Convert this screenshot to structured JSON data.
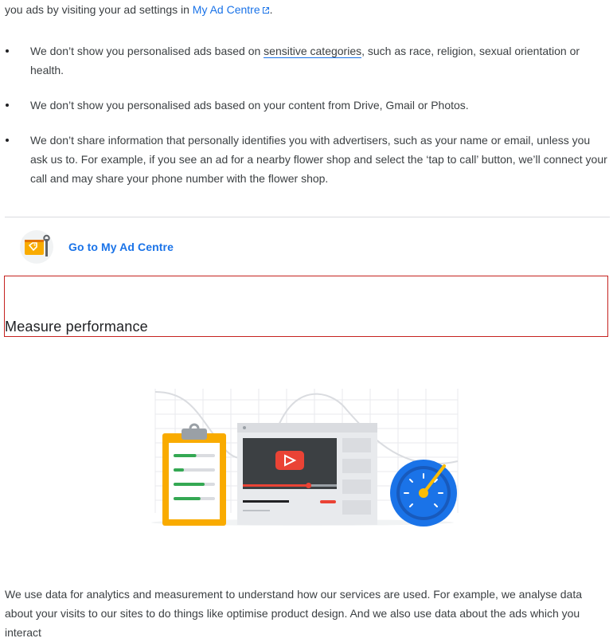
{
  "intro": {
    "prefix": "you ads by visiting your ad settings in ",
    "link": "My Ad Centre",
    "suffix": "."
  },
  "bullets": [
    {
      "pre": "We don’t show you personalised ads based on ",
      "link": "sensitive categories",
      "post": ", such as race, religion, sexual orientation or health."
    },
    {
      "text": "We don’t show you personalised ads based on your content from Drive, Gmail or Photos."
    },
    {
      "text": "We don’t share information that personally identifies you with advertisers, such as your name or email, unless you ask us to. For example, if you see an ad for a nearby flower shop and select the ‘tap to call’ button, we’ll connect your call and may share your phone number with the flower shop."
    }
  ],
  "ad_centre": {
    "link_label": "Go to My Ad Centre",
    "icon": "ad-settings-tag-wrench-icon"
  },
  "section": {
    "title": "Measure performance"
  },
  "illustration": {
    "name": "measure-performance-illustration",
    "progress": [
      0.55,
      0.25,
      0.75,
      0.65
    ],
    "video_progress": 0.7
  },
  "body": {
    "paragraph": "We use data for analytics and measurement to understand how our services are used. For example, we analyse data about your visits to our sites to do things like optimise product design. And we also use data about the ads which you interact"
  },
  "colors": {
    "link": "#1a73e8",
    "text": "#3c4043",
    "heading": "#202124",
    "highlight_border": "#c5221f",
    "accent_yellow": "#f9ab00",
    "accent_red": "#ea4335",
    "accent_green": "#34a853",
    "accent_blue": "#1a73e8"
  }
}
